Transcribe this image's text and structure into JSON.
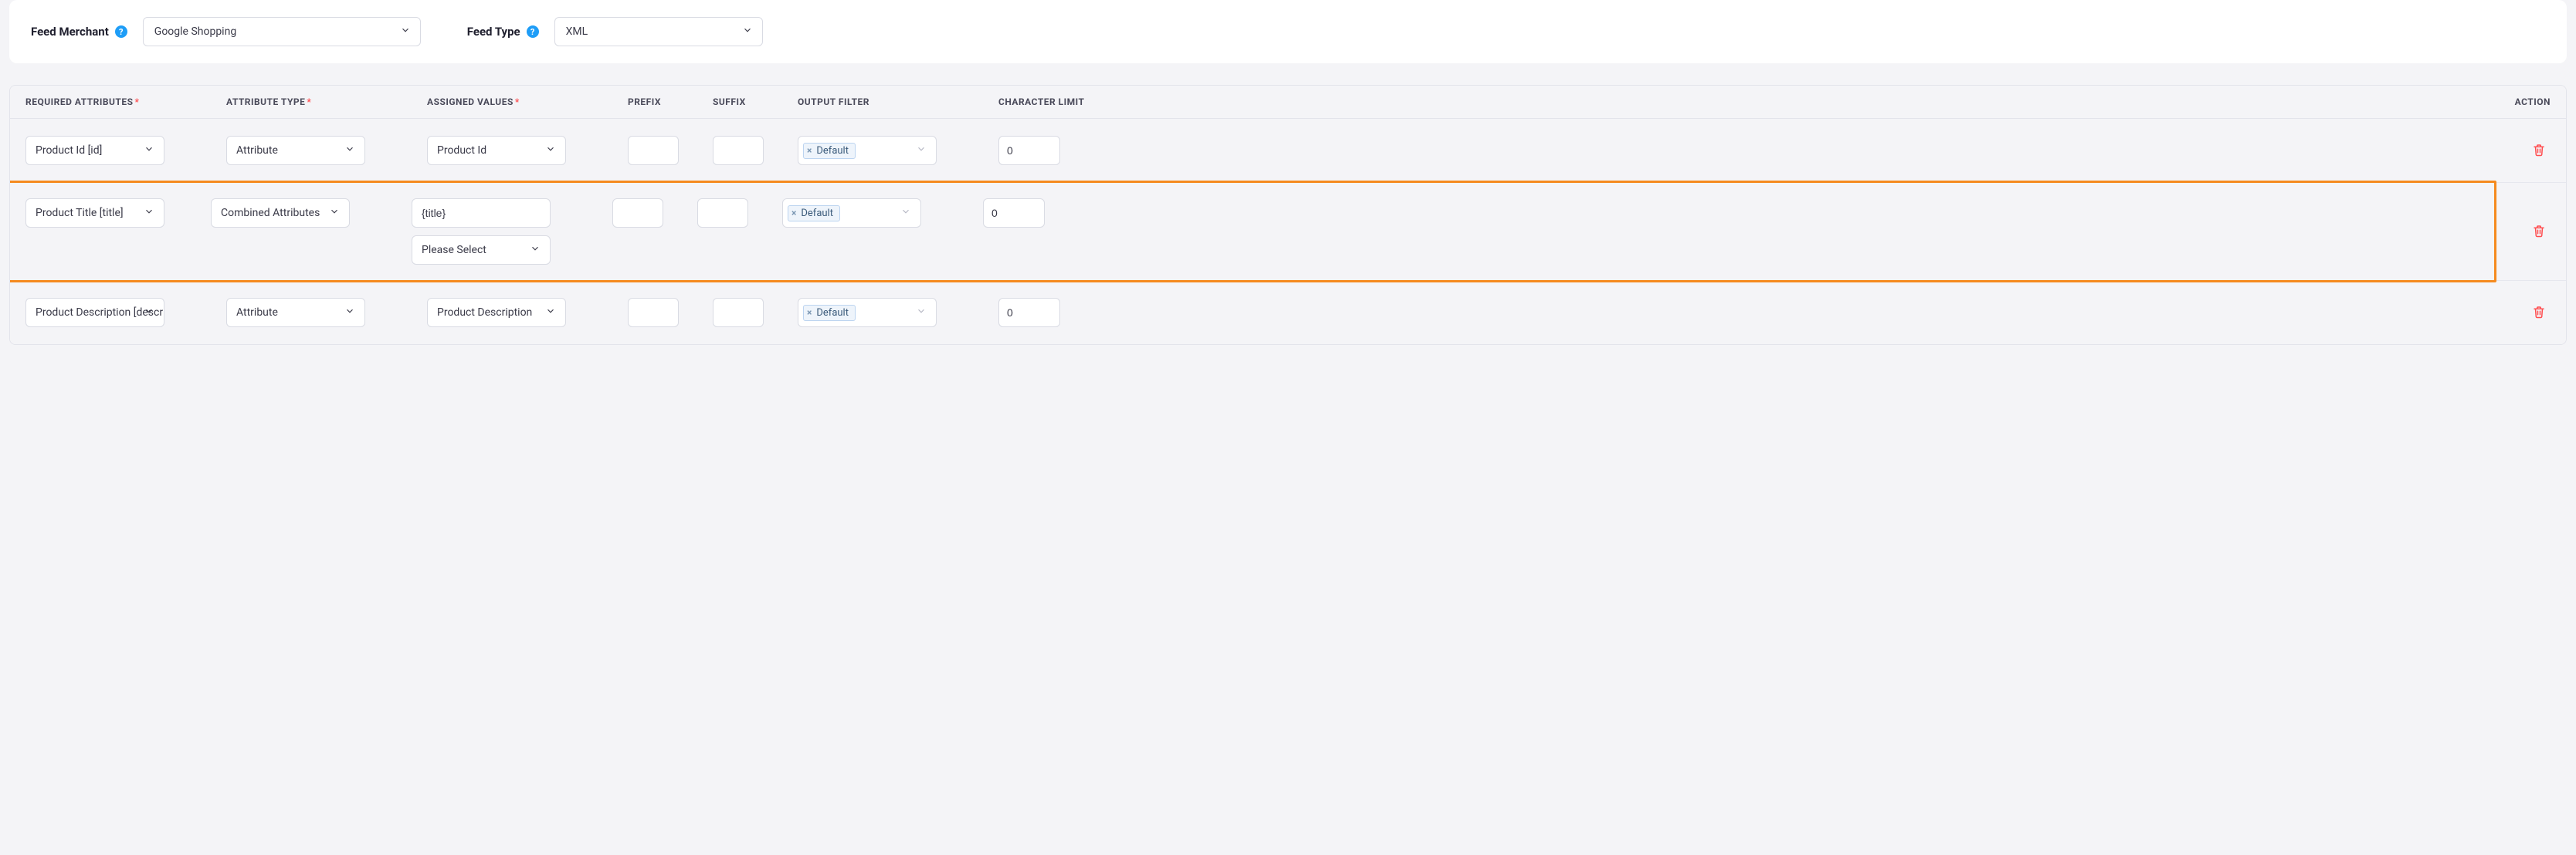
{
  "top": {
    "merchant_label": "Feed Merchant",
    "merchant_value": "Google Shopping",
    "type_label": "Feed Type",
    "type_value": "XML",
    "help_glyph": "?"
  },
  "headers": {
    "required": "REQUIRED ATTRIBUTES",
    "attrtype": "ATTRIBUTE TYPE",
    "assigned": "ASSIGNED VALUES",
    "prefix": "PREFIX",
    "suffix": "SUFFIX",
    "output": "OUTPUT FILTER",
    "charlimit": "CHARACTER LIMIT",
    "action": "ACTION",
    "star": "*"
  },
  "rows": [
    {
      "required": "Product Id [id]",
      "attrtype": "Attribute",
      "assigned_mode": "select",
      "assigned_value": "Product Id",
      "prefix": "",
      "suffix": "",
      "output_tag": "Default",
      "charlimit": "0",
      "highlighted": false
    },
    {
      "required": "Product Title [title]",
      "attrtype": "Combined Attributes",
      "assigned_mode": "combined",
      "assigned_text": "{title}",
      "assigned_extra_select": "Please Select",
      "prefix": "",
      "suffix": "",
      "output_tag": "Default",
      "charlimit": "0",
      "highlighted": true
    },
    {
      "required": "Product Description [description]",
      "attrtype": "Attribute",
      "assigned_mode": "select",
      "assigned_value": "Product Description",
      "prefix": "",
      "suffix": "",
      "output_tag": "Default",
      "charlimit": "0",
      "highlighted": false
    }
  ]
}
